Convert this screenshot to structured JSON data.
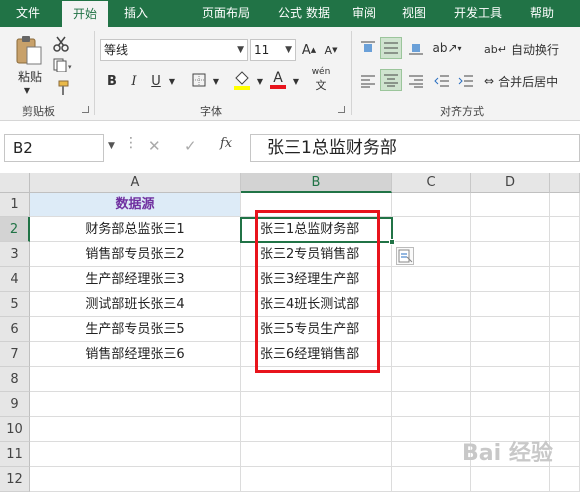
{
  "tabs": [
    "文件",
    "开始",
    "插入",
    "页面布局",
    "公式",
    "数据",
    "审阅",
    "视图",
    "开发工具",
    "帮助"
  ],
  "ribbon": {
    "clipboard": {
      "paste_label": "粘贴",
      "group_label": "剪贴板"
    },
    "font": {
      "font_name": "等线",
      "font_size": "11",
      "bold": "B",
      "italic": "I",
      "underline": "U",
      "phonetic": "wén",
      "group_label": "字体"
    },
    "alignment": {
      "wrap_label": "自动换行",
      "merge_label": "合并后居中",
      "group_label": "对齐方式"
    }
  },
  "formula_bar": {
    "name_box": "B2",
    "fx": "fx",
    "content": "张三1总监财务部"
  },
  "columns": [
    "A",
    "B",
    "C",
    "D"
  ],
  "rows": [
    "1",
    "2",
    "3",
    "4",
    "5",
    "6",
    "7",
    "8",
    "9",
    "10",
    "11",
    "12"
  ],
  "cells": {
    "a": [
      "数据源",
      "财务部总监张三1",
      "销售部专员张三2",
      "生产部经理张三3",
      "测试部班长张三4",
      "生产部专员张三5",
      "销售部经理张三6"
    ],
    "b": [
      "",
      "张三1总监财务部",
      "张三2专员销售部",
      "张三3经理生产部",
      "张三4班长测试部",
      "张三5专员生产部",
      "张三6经理销售部"
    ]
  },
  "watermark": "Bai 经验",
  "colors": {
    "excel_green": "#217346",
    "highlight": "#e8141c",
    "header_fill": "#ddebf7",
    "header_text": "#7030a0"
  }
}
